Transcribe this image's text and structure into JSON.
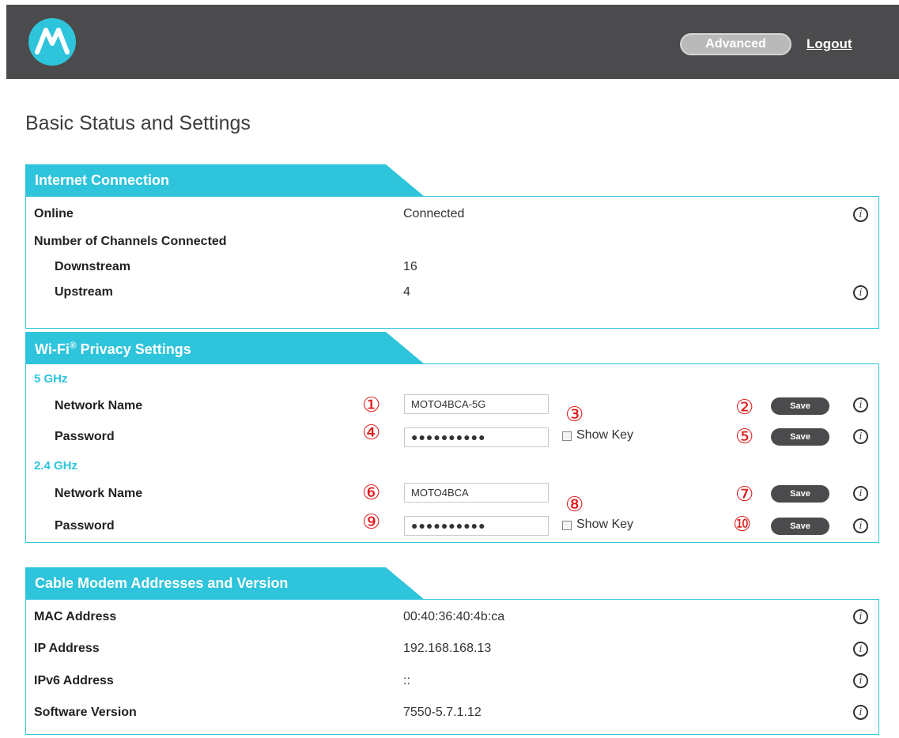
{
  "header": {
    "logo": "motorola-logo",
    "advanced_label": "Advanced",
    "logout_label": "Logout"
  },
  "page_title": "Basic Status and Settings",
  "internet": {
    "title": "Internet Connection",
    "online_label": "Online",
    "online_value": "Connected",
    "channels_label": "Number of Channels Connected",
    "downstream_label": "Downstream",
    "downstream_value": "16",
    "upstream_label": "Upstream",
    "upstream_value": "4"
  },
  "wifi": {
    "title": "Wi-Fi",
    "title_sup": "®",
    "title_rest": " Privacy Settings",
    "band5": {
      "label": "5 GHz",
      "network_label": "Network Name",
      "network_value": "MOTO4BCA-5G",
      "password_label": "Password",
      "password_value": "●●●●●●●●●●",
      "show_key_label": "Show Key",
      "save_label": "Save"
    },
    "band24": {
      "label": "2.4 GHz",
      "network_label": "Network Name",
      "network_value": "MOTO4BCA",
      "password_label": "Password",
      "password_value": "●●●●●●●●●●",
      "show_key_label": "Show Key",
      "save_label": "Save"
    },
    "markers": [
      "①",
      "②",
      "③",
      "④",
      "⑤",
      "⑥",
      "⑦",
      "⑧",
      "⑨",
      "⑩"
    ]
  },
  "cable": {
    "title": "Cable Modem Addresses and Version",
    "mac_label": "MAC Address",
    "mac_value": "00:40:36:40:4b:ca",
    "ip_label": "IP Address",
    "ip_value": "192.168.168.13",
    "ipv6_label": "IPv6 Address",
    "ipv6_value": "::",
    "sw_label": "Software Version",
    "sw_value": "7550-5.7.1.12"
  },
  "info_icon_glyph": "i",
  "colors": {
    "accent": "#2ec4db",
    "header_bg": "#4b4b4d",
    "marker": "#e01b1b",
    "save_button": "#4b4b4d"
  }
}
